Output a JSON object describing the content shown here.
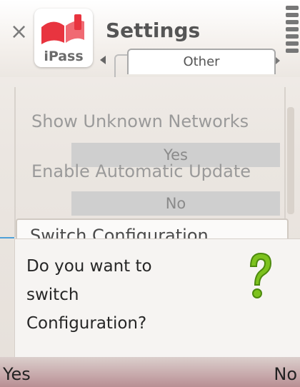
{
  "header": {
    "app_logo_text": "iPass",
    "title": "Settings",
    "tab_label": "Other"
  },
  "settings": [
    {
      "label": "Show Unknown Networks",
      "value": "Yes"
    },
    {
      "label": "Enable Automatic Update",
      "value": "No"
    },
    {
      "label": "Switch Configuration"
    }
  ],
  "dialog": {
    "line1": "Do you want to",
    "line2": "switch",
    "line3": "Configuration?",
    "icon": "question-mark-icon"
  },
  "softkeys": {
    "left": "Yes",
    "right": "No"
  },
  "colors": {
    "logo_red": "#e8343f",
    "question_green": "#7dc21e"
  }
}
